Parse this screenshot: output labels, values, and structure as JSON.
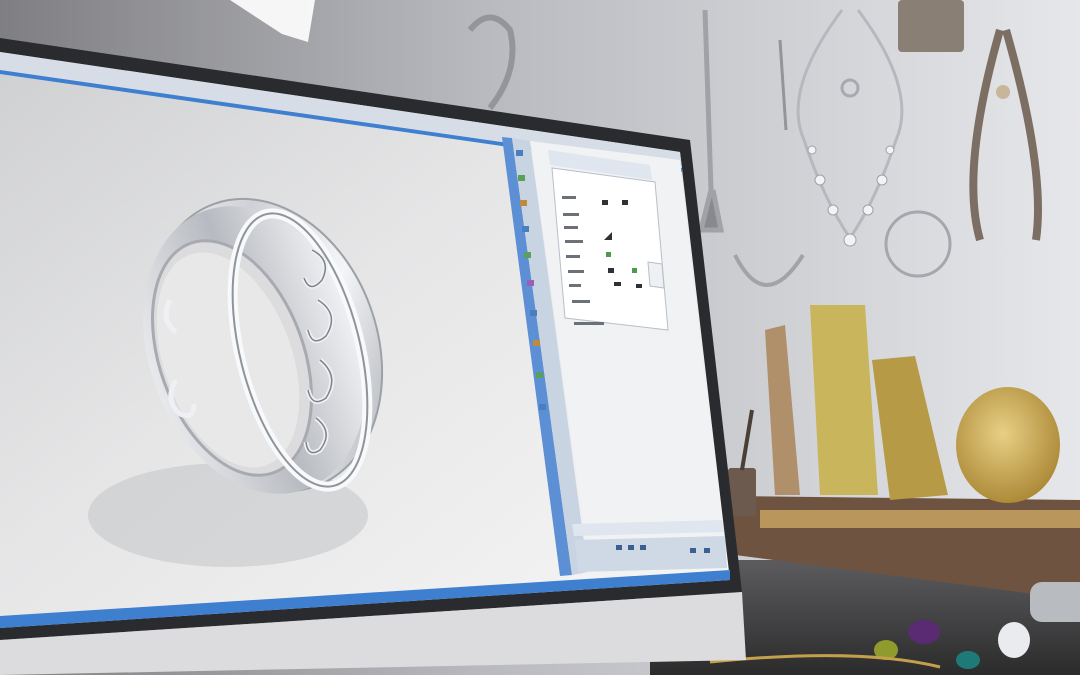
{
  "scene": {
    "description_visible_text": [],
    "colors": {
      "wall": "#dfe0e4",
      "monitor_bezel": "#2b2c2f",
      "screen_bg": "#e9e9ea",
      "ui_blue": "#3e7fd0",
      "panel_bg": "#f3f4f6",
      "wood": "#6b5342",
      "gold": "#c9a94b",
      "silver": "#d9dadd"
    }
  },
  "ui": {
    "toolbar_tab_label": "",
    "panel_title": "",
    "panel_rows": [],
    "status_left": "",
    "status_right": ""
  }
}
